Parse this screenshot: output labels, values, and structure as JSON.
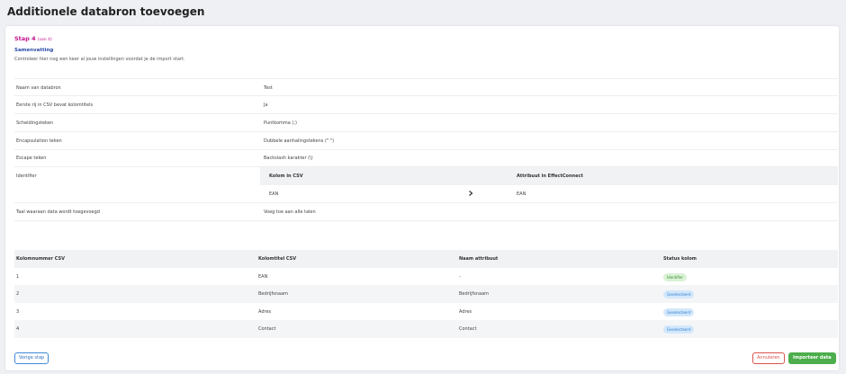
{
  "page": {
    "title": "Additionele databron toevoegen"
  },
  "step": {
    "label": "Stap 4",
    "of": "(van 4)"
  },
  "summary": {
    "title": "Samenvatting",
    "description": "Controleer hier nog een keer al jouw instellingen voordat je de import start."
  },
  "settings": [
    {
      "label": "Naam van databron",
      "value": "Test"
    },
    {
      "label": "Eerste rij in CSV bevat kolomtitels",
      "value": "Ja"
    },
    {
      "label": "Scheidingsteken",
      "value": "Puntkomma (;)"
    },
    {
      "label": "Encapsulation teken",
      "value": "Dubbele aanhalingstekens (\" \")"
    },
    {
      "label": "Escape teken",
      "value": "Backslash karakter (\\)"
    }
  ],
  "identifier": {
    "label": "Identifier",
    "col_csv_header": "Kolom in CSV",
    "attr_header": "Attribuut in EffectConnect",
    "csv_value": "EAN",
    "attr_value": "EAN"
  },
  "language": {
    "label": "Taal waaraan data wordt toegevoegd",
    "value": "Voeg toe aan alle talen"
  },
  "columns": {
    "headers": [
      "Kolomnummer CSV",
      "Kolomtitel CSV",
      "Naam attribuut",
      "Status kolom"
    ],
    "rows": [
      {
        "num": "1",
        "title": "EAN",
        "attr": "-",
        "status": "Identifier"
      },
      {
        "num": "2",
        "title": "Bedrijfsnaam",
        "attr": "Bedrijfsnaam",
        "status": "Geselecteerd"
      },
      {
        "num": "3",
        "title": "Adres",
        "attr": "Adres",
        "status": "Geselecteerd"
      },
      {
        "num": "4",
        "title": "Contact",
        "attr": "Contact",
        "status": "Geselecteerd"
      }
    ]
  },
  "actions": {
    "prev": "Vorige stap",
    "cancel": "Annuleren",
    "import": "Importeer data"
  },
  "colors": {
    "accent_step": "#c2138f",
    "summary_title": "#2b4aa6",
    "identifier_badge": "#d9f2d5",
    "selected_badge": "#d3e8fb",
    "import_button": "#4cae4c",
    "cancel_button": "#d9534f",
    "prev_button": "#3f8ad8"
  },
  "icons": {
    "identifier_arrow": "chevron-right-icon"
  }
}
